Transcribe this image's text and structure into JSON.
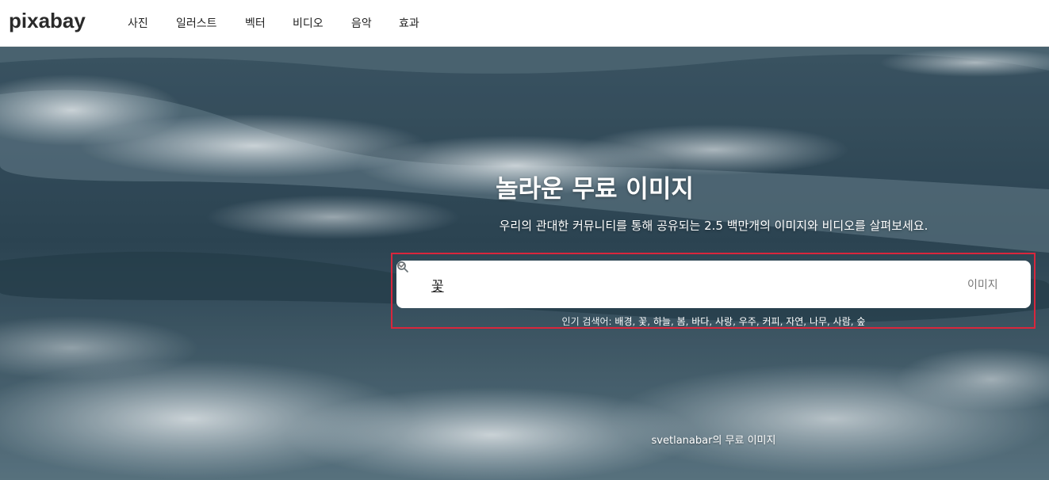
{
  "header": {
    "logo": "pixabay",
    "nav": [
      {
        "label": "사진"
      },
      {
        "label": "일러스트"
      },
      {
        "label": "벡터"
      },
      {
        "label": "비디오"
      },
      {
        "label": "음악"
      },
      {
        "label": "효과"
      }
    ]
  },
  "hero": {
    "title": "놀라운 무료 이미지",
    "subtitle": "우리의 관대한 커뮤니티를 통해 공유되는 2.5 백만개의 이미지와 비디오를 살펴보세요.",
    "credit": "svetlanabar의 무료 이미지"
  },
  "search": {
    "value": "꽃",
    "icon": "search-icon",
    "type_label": "이미지",
    "type_icon": "chevron-down-icon"
  },
  "popular": {
    "label": "인기 검색어:",
    "tags": [
      "배경",
      "꽃",
      "하늘",
      "봄",
      "바다",
      "사랑",
      "우주",
      "커피",
      "자연",
      "나무",
      "사람",
      "숲"
    ]
  },
  "colors": {
    "accent_highlight": "#d9263c",
    "ocean_dark": "#2f4a58",
    "ocean_mid": "#4a6470",
    "foam": "#dfe7ea"
  }
}
